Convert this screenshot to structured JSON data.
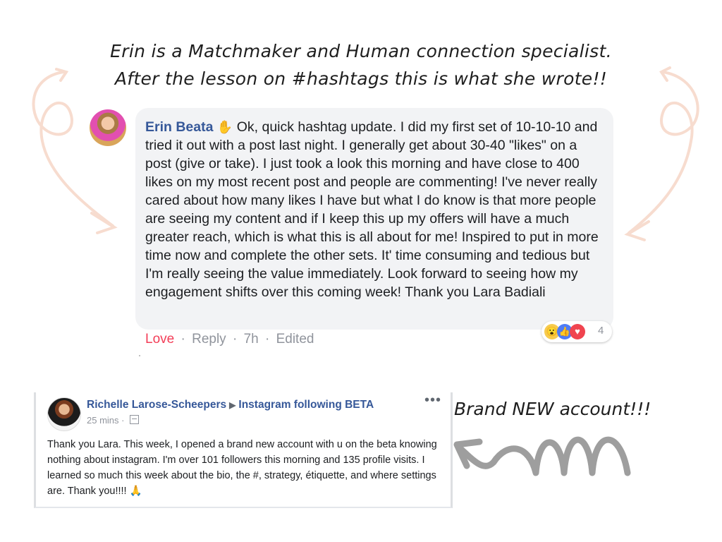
{
  "headline": {
    "line1": "Erin is a Matchmaker and Human connection specialist.",
    "line2": "After the lesson on #hashtags this is what she wrote!!"
  },
  "comment1": {
    "author": "Erin Beata",
    "wave_icon": "waving-hand-icon",
    "text": "Ok, quick hashtag update. I did my first set of 10-10-10 and tried it out with a post last night. I generally get about 30-40 \"likes\" on a post (give or take). I just took a look this morning and have close to 400 likes on my most recent post and people are commenting! I've never really cared about how many likes I have but what I do know is that more people are seeing my content and if I keep this up my offers will have a much greater reach, which is what this is all about for me! Inspired to put in more time now and complete the other sets. It' time consuming and tedious but I'm really seeing the value immediately. Look forward to seeing how my engagement shifts over this coming week! Thank you Lara Badiali",
    "actions": {
      "love": "Love",
      "reply": "Reply",
      "time": "7h",
      "edited": "Edited"
    },
    "reactions": {
      "count": "4",
      "icons": [
        "wow-icon",
        "like-icon",
        "love-icon"
      ]
    }
  },
  "post2": {
    "author": "Richelle Larose-Scheepers",
    "group": "Instagram following BETA",
    "time": "25 mins",
    "more_label": "•••",
    "text": "Thank you Lara. This week, I opened a brand new account with u on the beta knowing nothing about instagram. I'm over 101 followers this morning and 135 profile visits. I learned so much this week about the bio, the #, strategy, étiquette, and where settings are. Thank you!!!!",
    "emoji": "🙏"
  },
  "annotation": {
    "brand_new": "Brand NEW account!!!"
  },
  "colors": {
    "link_blue": "#365899",
    "love_red": "#f33e58",
    "bubble_gray": "#f2f3f5",
    "deco_peach": "#f7dccf",
    "arrow_gray": "#9e9e9e"
  }
}
